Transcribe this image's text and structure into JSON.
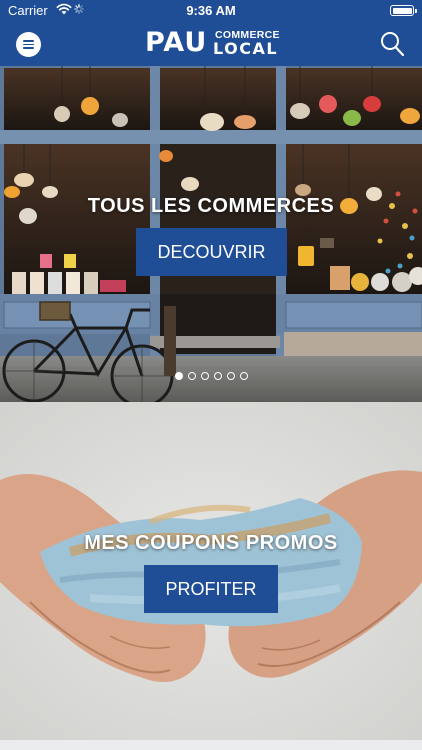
{
  "status_bar": {
    "carrier": "Carrier",
    "time": "9:36 AM",
    "wifi_icon": "wifi-icon",
    "battery_icon": "battery-icon",
    "battery_level": 1.0
  },
  "header": {
    "menu_icon": "menu-icon",
    "logo_main": "PAU",
    "logo_top": "COMMERCE",
    "logo_bottom": "LOCAL",
    "search_icon": "search-icon"
  },
  "panels": [
    {
      "title": "TOUS LES COMMERCES",
      "button_label": "DECOUVRIR"
    },
    {
      "title": "MES COUPONS PROMOS",
      "button_label": "PROFITER"
    }
  ],
  "carousel": {
    "total": 6,
    "active_index": 0
  },
  "colors": {
    "primary": "#1f4e96",
    "on_primary": "#ffffff"
  }
}
